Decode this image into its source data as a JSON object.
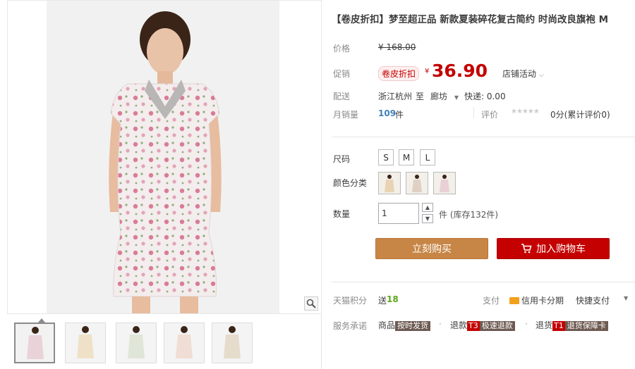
{
  "title": "【卷皮折扣】梦至超正品 新款夏装碎花复古简约 时尚改良旗袍 M",
  "price": {
    "label": "价格",
    "original": "¥ 168.00",
    "promo_label": "促销",
    "promo_tag": "卷皮折扣",
    "promo_currency": "¥",
    "promo_value": "36.90",
    "store_activity": "店铺活动"
  },
  "shipping": {
    "label": "配送",
    "from": "浙江杭州",
    "to_word": "至",
    "destination": "廊坊",
    "fee": "快递: 0.00"
  },
  "sales": {
    "label": "月销量",
    "count": "109",
    "unit": "件",
    "rating_label": "评价",
    "rating_text": "0分(累计评价0)"
  },
  "options": {
    "size_label": "尺码",
    "sizes": [
      "S",
      "M",
      "L"
    ],
    "color_label": "颜色分类",
    "quantity_label": "数量",
    "quantity_value": "1",
    "stock_text": "件 (库存132件)"
  },
  "actions": {
    "buy_now": "立刻购买",
    "add_to_cart": "加入购物车"
  },
  "points": {
    "label": "天猫积分",
    "send": "送",
    "amount": "18",
    "pay_label": "支付",
    "credit_card": "信用卡分期",
    "quick_pay": "快捷支付"
  },
  "service": {
    "label": "服务承诺",
    "item1_prefix": "商品",
    "item1_badge": "按时发货",
    "item2_prefix": "退款",
    "item2_t": "T3",
    "item2_badge": "极速退款",
    "item3_prefix": "退货",
    "item3_t": "T1",
    "item3_badge": "退货保障卡"
  },
  "colors": {
    "accent_red": "#c40000",
    "buy_orange": "#c78646",
    "link_blue": "#3f7fb7"
  }
}
